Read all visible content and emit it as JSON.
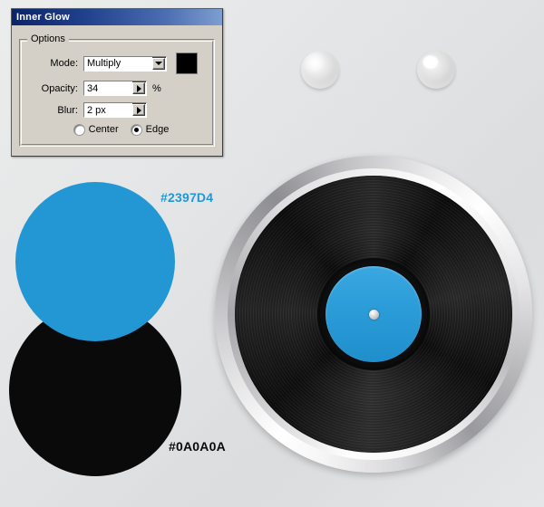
{
  "dialog": {
    "title": "Inner Glow",
    "group_label": "Options",
    "rows": {
      "mode": {
        "label": "Mode:",
        "value": "Multiply",
        "swatch_color": "#000000",
        "arrow_icon": "chevron-down-icon"
      },
      "opacity": {
        "label": "Opacity:",
        "value": "34",
        "suffix": "%",
        "arrow_icon": "chevron-right-icon"
      },
      "blur": {
        "label": "Blur:",
        "value": "2 px",
        "arrow_icon": "chevron-right-icon"
      }
    },
    "radios": [
      {
        "label": "Center",
        "checked": false
      },
      {
        "label": "Edge",
        "checked": true
      }
    ]
  },
  "swatches": {
    "blue": {
      "hex_label": "#2397D4",
      "color": "#2397D4"
    },
    "black": {
      "hex_label": "#0A0A0A",
      "color": "#0A0A0A"
    }
  },
  "spheres": [
    {
      "name": "sphere-soft-highlight"
    },
    {
      "name": "sphere-sharp-highlight"
    }
  ],
  "vinyl": {
    "rim_color": "#d8d8da",
    "disc_color": "#0A0A0A",
    "label_color": "#2397D4",
    "hole_color": "#bdbdbf"
  },
  "canvas": {
    "background_color": "#e4e5e6"
  }
}
